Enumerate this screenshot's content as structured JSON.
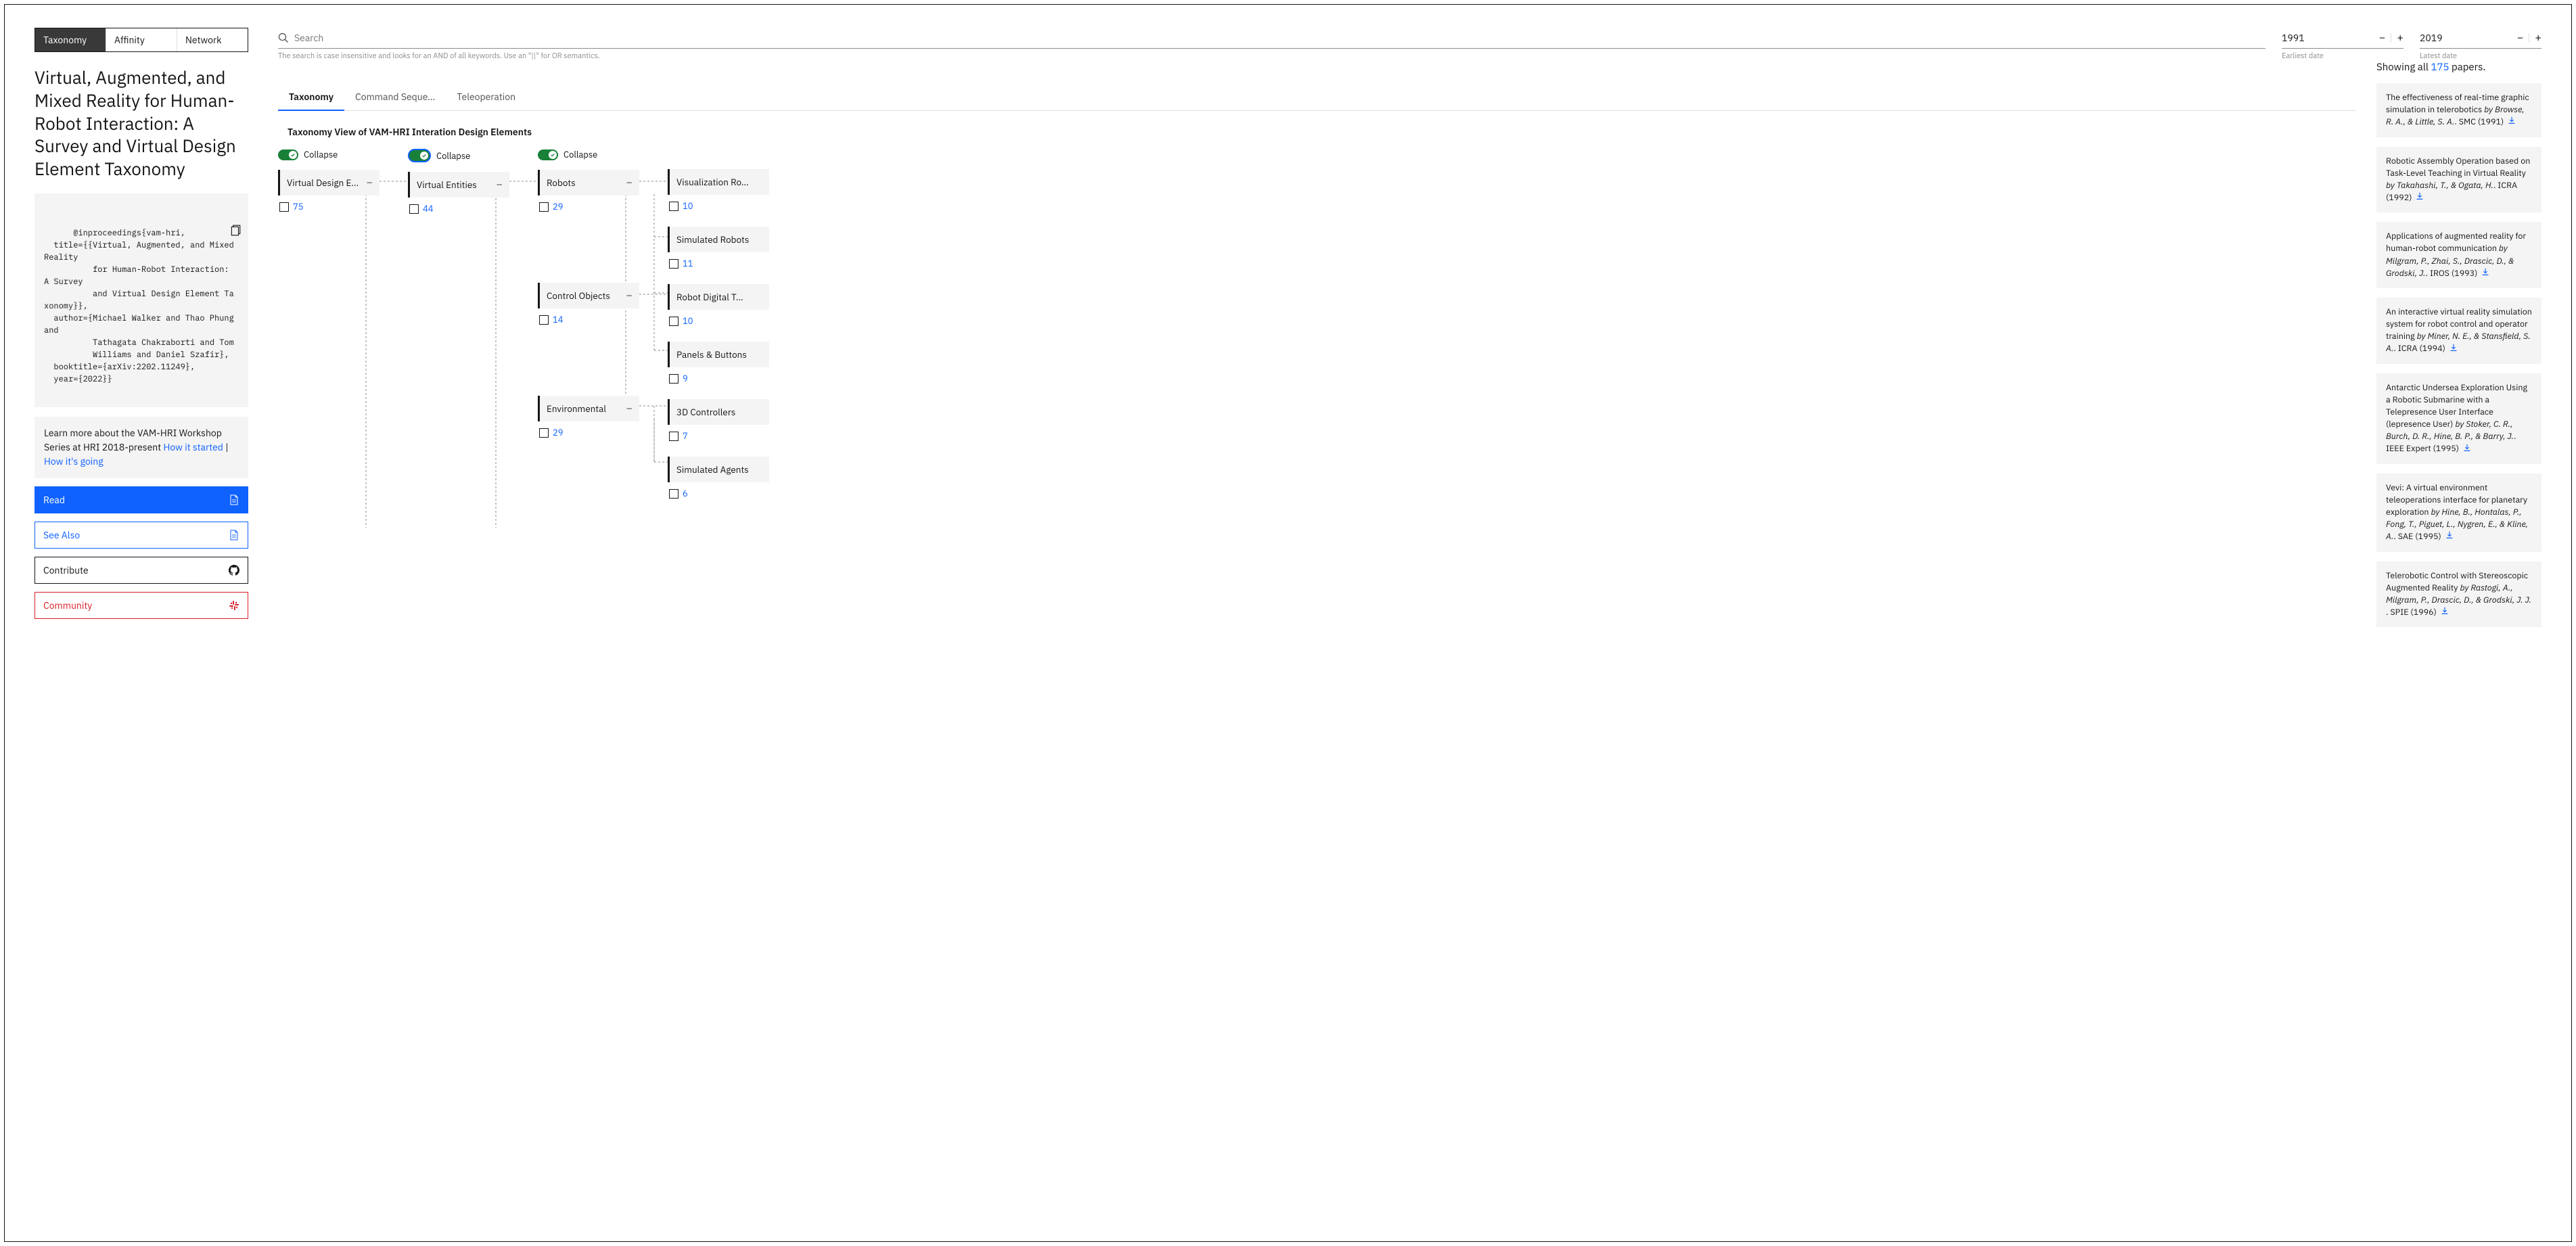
{
  "nav": {
    "tabs": [
      "Taxonomy",
      "Affinity",
      "Network"
    ]
  },
  "title": "Virtual, Augmented, and Mixed Reality for Human-Robot Interaction: A Survey and Virtual Design Element Taxonomy",
  "bibtex": "@inproceedings{vam-hri,\n  title={{Virtual, Augmented, and Mixed Reality\n          for Human-Robot Interaction: A Survey\n          and Virtual Design Element Taxonomy}},\n  author={Michael Walker and Thao Phung and\n          Tathagata Chakraborti and Tom\n          Williams and Daniel Szafir},\n  booktitle={arXiv:2202.11249},\n  year={2022}}",
  "learn": {
    "prefix": "Learn more about the VAM-HRI Workshop Series at HRI 2018-present ",
    "link1": "How it started",
    "sep": " | ",
    "link2": "How it's going"
  },
  "buttons": {
    "read": "Read",
    "seealso": "See Also",
    "contribute": "Contribute",
    "community": "Community"
  },
  "search": {
    "placeholder": "Search",
    "hint": "The search is case insensitive and looks for an AND of all keywords. Use an \"||\" for OR semantics."
  },
  "years": {
    "from": {
      "val": "1991",
      "label": "Earliest date"
    },
    "to": {
      "val": "2019",
      "label": "Latest date"
    }
  },
  "subtabs": [
    "Taxonomy",
    "Command Seque…",
    "Teleoperation"
  ],
  "view_title": "Taxonomy View of VAM-HRI Interation Design Elements",
  "collapse_label": "Collapse",
  "tree": {
    "col1": [
      {
        "label": "Virtual Design E…",
        "count": "75",
        "exp": true
      }
    ],
    "col2": [
      {
        "label": "Virtual Entities",
        "count": "44",
        "exp": true
      }
    ],
    "col3": [
      {
        "label": "Robots",
        "count": "29",
        "exp": true
      },
      {
        "label": "Control Objects",
        "count": "14",
        "exp": true
      },
      {
        "label": "Environmental",
        "count": "29",
        "exp": true
      }
    ],
    "col4": [
      {
        "label": "Visualization Ro…",
        "count": "10"
      },
      {
        "label": "Simulated Robots",
        "count": "11"
      },
      {
        "label": "Robot Digital T…",
        "count": "10"
      },
      {
        "label": "Panels & Buttons",
        "count": "9"
      },
      {
        "label": "3D Controllers",
        "count": "7"
      },
      {
        "label": "Simulated Agents",
        "count": "6"
      }
    ]
  },
  "results": {
    "showing_pre": "Showing all ",
    "count": "175",
    "showing_post": " papers."
  },
  "papers": [
    {
      "title": "The effectiveness of real-time graphic simulation in telerobotics ",
      "authors": "by Browse, R. A., & Little, S. A.",
      "venue": ". SMC (1991) "
    },
    {
      "title": "Robotic Assembly Operation based on Task-Level Teaching in Virtual Reality ",
      "authors": "by Takahashi, T., & Ogata, H.",
      "venue": ". ICRA (1992) "
    },
    {
      "title": "Applications of augmented reality for human-robot communication ",
      "authors": "by Milgram, P., Zhai, S., Drascic, D., & Grodski, J.",
      "venue": ". IROS (1993) "
    },
    {
      "title": "An interactive virtual reality simulation system for robot control and operator training ",
      "authors": "by Miner, N. E., & Stansfield, S. A.",
      "venue": ". ICRA (1994) "
    },
    {
      "title": "Antarctic Undersea Exploration Using a Robotic Submarine with a Telepresence User Interface (lepresence User) ",
      "authors": "by Stoker, C. R., Burch, D. R., Hine, B. P., & Barry, J.",
      "venue": ". IEEE Expert (1995) "
    },
    {
      "title": "Vevi: A virtual environment teleoperations interface for planetary exploration ",
      "authors": "by Hine, B., Hontalas, P., Fong, T., Piguet, L., Nygren, E., & Kline, A.",
      "venue": ". SAE (1995) "
    },
    {
      "title": "Telerobotic Control with Stereoscopic Augmented Reality ",
      "authors": "by Rastogi, A., Milgram, P., Drascic, D., & Grodski, J. J. ",
      "venue": ". SPIE (1996) "
    }
  ]
}
